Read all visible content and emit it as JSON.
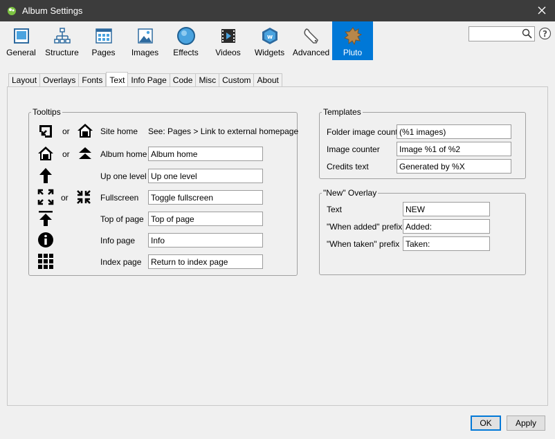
{
  "window": {
    "title": "Album Settings",
    "close_glyph": "✕"
  },
  "toolbar": {
    "items": [
      {
        "label": "General",
        "icon": "general-icon"
      },
      {
        "label": "Structure",
        "icon": "structure-icon"
      },
      {
        "label": "Pages",
        "icon": "pages-icon"
      },
      {
        "label": "Images",
        "icon": "images-icon"
      },
      {
        "label": "Effects",
        "icon": "effects-icon"
      },
      {
        "label": "Videos",
        "icon": "videos-icon"
      },
      {
        "label": "Widgets",
        "icon": "widgets-icon"
      },
      {
        "label": "Advanced",
        "icon": "advanced-icon"
      },
      {
        "label": "Pluto",
        "icon": "pluto-icon"
      }
    ],
    "active": "Pluto",
    "accent": "#0078d7"
  },
  "search": {
    "value": ""
  },
  "tabs": [
    "Layout",
    "Overlays",
    "Fonts",
    "Text",
    "Info Page",
    "Code",
    "Misc",
    "Custom",
    "About"
  ],
  "active_tab": "Text",
  "tooltips": {
    "legend": "Tooltips",
    "or": "or",
    "site_home": {
      "label": "Site home",
      "note": "See: Pages > Link to external homepage"
    },
    "album_home": {
      "label": "Album home",
      "value": "Album home"
    },
    "up_one_level": {
      "label": "Up one level",
      "value": "Up one level"
    },
    "fullscreen": {
      "label": "Fullscreen",
      "value": "Toggle fullscreen"
    },
    "top_of_page": {
      "label": "Top of page",
      "value": "Top of page"
    },
    "info_page": {
      "label": "Info page",
      "value": "Info"
    },
    "index_page": {
      "label": "Index page",
      "value": "Return to index page"
    }
  },
  "templates": {
    "legend": "Templates",
    "folder_image_count": {
      "label": "Folder image count",
      "value": "(%1 images)"
    },
    "image_counter": {
      "label": "Image counter",
      "value": "Image %1 of %2"
    },
    "credits_text": {
      "label": "Credits text",
      "value": "Generated by %X"
    }
  },
  "new_overlay": {
    "legend": "\"New\" Overlay",
    "text": {
      "label": "Text",
      "value": "NEW"
    },
    "when_added": {
      "label": "\"When added\" prefix",
      "value": "Added:"
    },
    "when_taken": {
      "label": "\"When taken\" prefix",
      "value": "Taken:"
    }
  },
  "buttons": {
    "ok": "OK",
    "apply": "Apply"
  }
}
